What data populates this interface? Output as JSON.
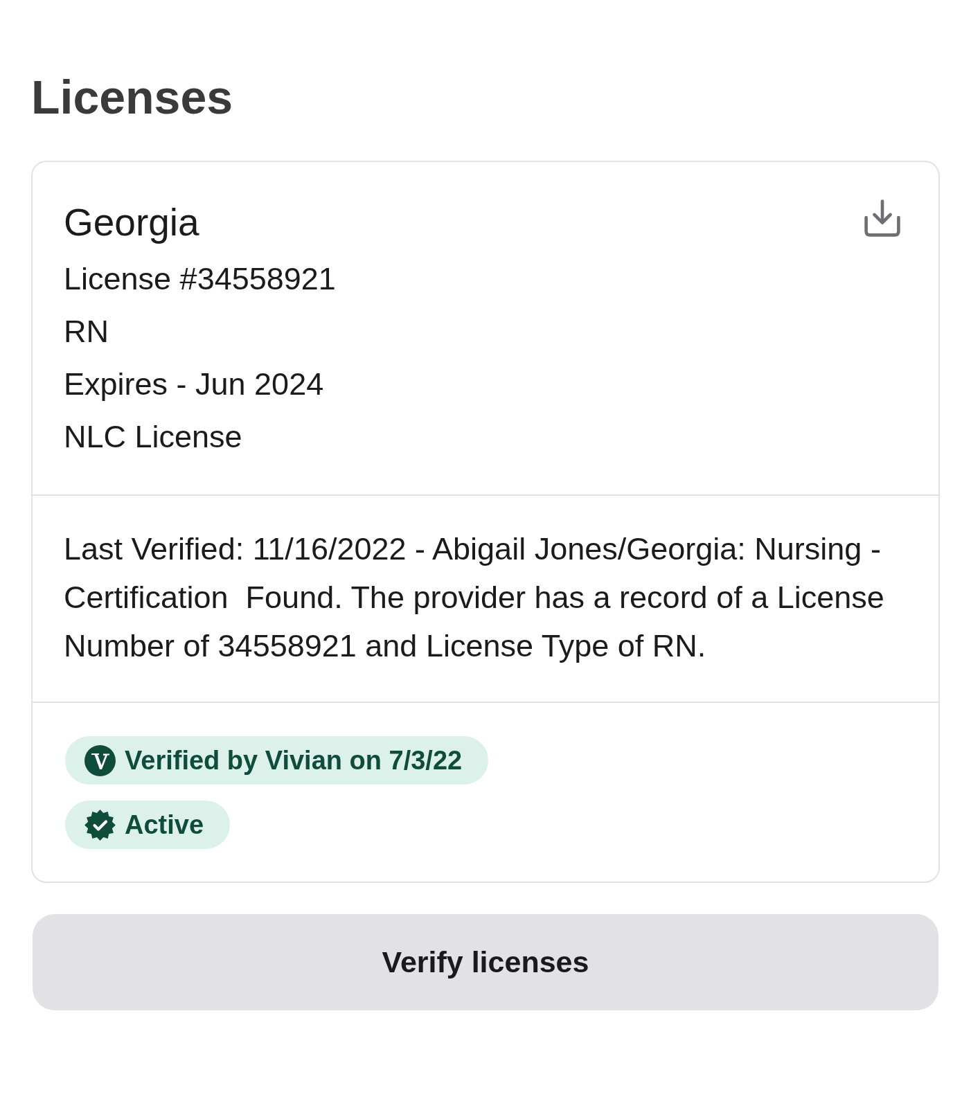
{
  "page": {
    "title": "Licenses"
  },
  "licenses": [
    {
      "state": "Georgia",
      "details": [
        "License #34558921",
        "RN",
        "Expires - Jun 2024",
        "NLC License"
      ],
      "verification_note": "Last Verified: 11/16/2022 - Abigail Jones/Georgia: Nursing - Certification  Found. The provider has a record of a License Number of 34558921 and License Type of RN.",
      "badges": [
        {
          "kind": "vendor",
          "label": "Verified by Vivian on 7/3/22"
        },
        {
          "kind": "status",
          "label": "Active"
        }
      ]
    }
  ],
  "actions": {
    "verify_button": "Verify licenses"
  }
}
